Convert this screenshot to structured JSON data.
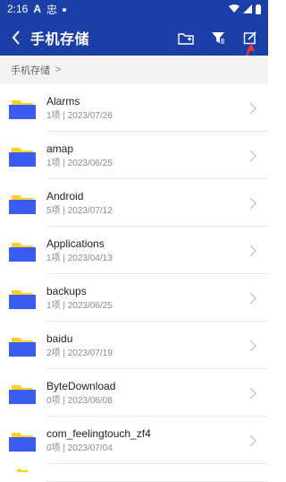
{
  "status": {
    "time": "2:16",
    "sb_letter": "A",
    "sb_app": "忠"
  },
  "header": {
    "title": "手机存储",
    "icons": [
      "new-folder-icon",
      "filter-icon",
      "edit-icon"
    ]
  },
  "breadcrumb": {
    "path": "手机存储"
  },
  "folders": [
    {
      "name": "Alarms",
      "sub": "1项 | 2023/07/26"
    },
    {
      "name": "amap",
      "sub": "1项 | 2023/06/25"
    },
    {
      "name": "Android",
      "sub": "5项 | 2023/07/12"
    },
    {
      "name": "Applications",
      "sub": "1项 | 2023/04/13"
    },
    {
      "name": "backups",
      "sub": "1项 | 2023/06/25"
    },
    {
      "name": "baidu",
      "sub": "2项 | 2023/07/19"
    },
    {
      "name": "ByteDownload",
      "sub": "0项 | 2023/06/08"
    },
    {
      "name": "com_feelingtouch_zf4",
      "sub": "0项 | 2023/07/04"
    }
  ],
  "colors": {
    "header_bg": "#1b3fa6",
    "folder_blue": "#3b5cf0",
    "folder_yellow": "#ffd21f",
    "annotation_red": "#e53935"
  }
}
